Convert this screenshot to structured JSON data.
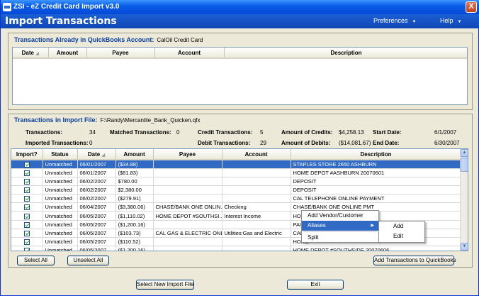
{
  "window": {
    "title": "ZSI - eZ Credit Card Import v3.0",
    "close": "X"
  },
  "header": {
    "title": "Import Transactions",
    "menu": [
      {
        "label": "Preferences"
      },
      {
        "label": "Help"
      }
    ]
  },
  "existing": {
    "title": "Transactions Already in QuickBooks Account:",
    "account": "CalOil Credit Card",
    "columns": [
      "Date",
      "Amount",
      "Payee",
      "Account",
      "Description"
    ]
  },
  "import": {
    "title": "Transactions in Import File:",
    "file": "F:\\Randy\\Mercantile_Bank_Quicken.qfx",
    "summary": {
      "transactions_label": "Transactions:",
      "transactions": "34",
      "imported_label": "Imported Transactions:",
      "imported": "0",
      "matched_label": "Matched Transactions:",
      "matched": "0",
      "credit_label": "Credit Transactions:",
      "credit": "5",
      "debit_label": "Debit Transactions:",
      "debit": "29",
      "amount_credits_label": "Amount of Credits:",
      "amount_credits": "$4,258.13",
      "amount_debits_label": "Amount of Debits:",
      "amount_debits": "($14,081.67)",
      "start_label": "Start Date:",
      "start": "6/1/2007",
      "end_label": "End Date:",
      "end": "6/30/2007"
    },
    "columns": [
      "Import?",
      "Status",
      "Date",
      "Amount",
      "Payee",
      "Account",
      "Description"
    ],
    "rows": [
      {
        "status": "Unmatched",
        "date": "06/01/2007",
        "amount": "($34.88)",
        "payee": "",
        "account": "",
        "description": "STAPLES STORE 2650  ASHBURN"
      },
      {
        "status": "Unmatched",
        "date": "06/01/2007",
        "amount": "($81.83)",
        "payee": "",
        "account": "",
        "description": "HOME DEPOT #ASHBURN 20070601"
      },
      {
        "status": "Unmatched",
        "date": "06/02/2007",
        "amount": "$780.00",
        "payee": "",
        "account": "",
        "description": "DEPOSIT"
      },
      {
        "status": "Unmatched",
        "date": "06/02/2007",
        "amount": "$2,380.00",
        "payee": "",
        "account": "",
        "description": "DEPOSIT"
      },
      {
        "status": "Unmatched",
        "date": "06/02/2007",
        "amount": "($279.91)",
        "payee": "",
        "account": "",
        "description": "CAL TELEPHONE ONLINE PAYMENT"
      },
      {
        "status": "Unmatched",
        "date": "06/04/2007",
        "amount": "($3,380.06)",
        "payee": "CHASE/BANK ONE   ONLIN...",
        "account": "Checking",
        "description": "CHASE/BANK ONE  ONLINE PMT"
      },
      {
        "status": "Unmatched",
        "date": "06/05/2007",
        "amount": "($1,110.02)",
        "payee": "HOME  DEPOT  #SOUTHSI...",
        "account": "Interest Income",
        "description": "HOME"
      },
      {
        "status": "Unmatched",
        "date": "06/05/2007",
        "amount": "($1,200.16)",
        "payee": "",
        "account": "",
        "description": "PAID"
      },
      {
        "status": "Unmatched",
        "date": "06/05/2007",
        "amount": "($103.73)",
        "payee": "CAL GAS & ELECTRIC ONL...",
        "account": "Utilities:Gas and Electric",
        "description": "CAL"
      },
      {
        "status": "Unmatched",
        "date": "06/05/2007",
        "amount": "($110.52)",
        "payee": "",
        "account": "",
        "description": "HOME"
      },
      {
        "status": "Unmatched",
        "date": "06/05/2007",
        "amount": "($1,200.16)",
        "payee": "",
        "account": "",
        "description": "HOME DEPOT #SOUTHSIDE 20070606"
      },
      {
        "status": "Unmatched",
        "date": "06/06/2007",
        "amount": "($780.52)",
        "payee": "",
        "account": "",
        "description": "HOME DEPOT #SOUTHSIDE 20070606"
      }
    ]
  },
  "context_menu": {
    "items": [
      "Add Vendor/Customer",
      "Aliases",
      "Split"
    ],
    "submenu": [
      "Add",
      "Edit"
    ]
  },
  "buttons": {
    "select_all": "Select All",
    "unselect_all": "Unselect All",
    "add_to_qb": "Add Transactions to QuickBooks",
    "select_new_file": "Select New Import File",
    "exit": "Exit"
  }
}
